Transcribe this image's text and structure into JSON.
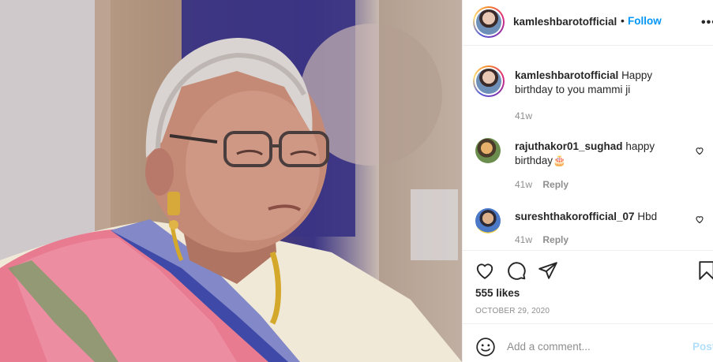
{
  "post": {
    "username": "kamleshbarotofficial",
    "separator": "•",
    "follow_label": "Follow",
    "more_label": "•••"
  },
  "caption": {
    "username": "kamleshbarotofficial",
    "text": "Happy birthday to you mammi ji",
    "time": "41w"
  },
  "comments": [
    {
      "username": "rajuthakor01_sughad",
      "text": "happy birthday🎂",
      "time": "41w",
      "reply_label": "Reply"
    },
    {
      "username": "sureshthakorofficial_07",
      "text": "Hbd",
      "time": "41w",
      "reply_label": "Reply"
    }
  ],
  "actions": {
    "icons": [
      "heart-icon",
      "comment-icon",
      "share-icon",
      "bookmark-icon"
    ],
    "likes": "555 likes",
    "date": "OCTOBER 29, 2020"
  },
  "add_comment": {
    "placeholder": "Add a comment...",
    "post_label": "Post"
  },
  "colors": {
    "accent": "#0095f6",
    "post_disabled": "#b2dffc",
    "muted": "#8e8e8e",
    "text": "#262626"
  }
}
